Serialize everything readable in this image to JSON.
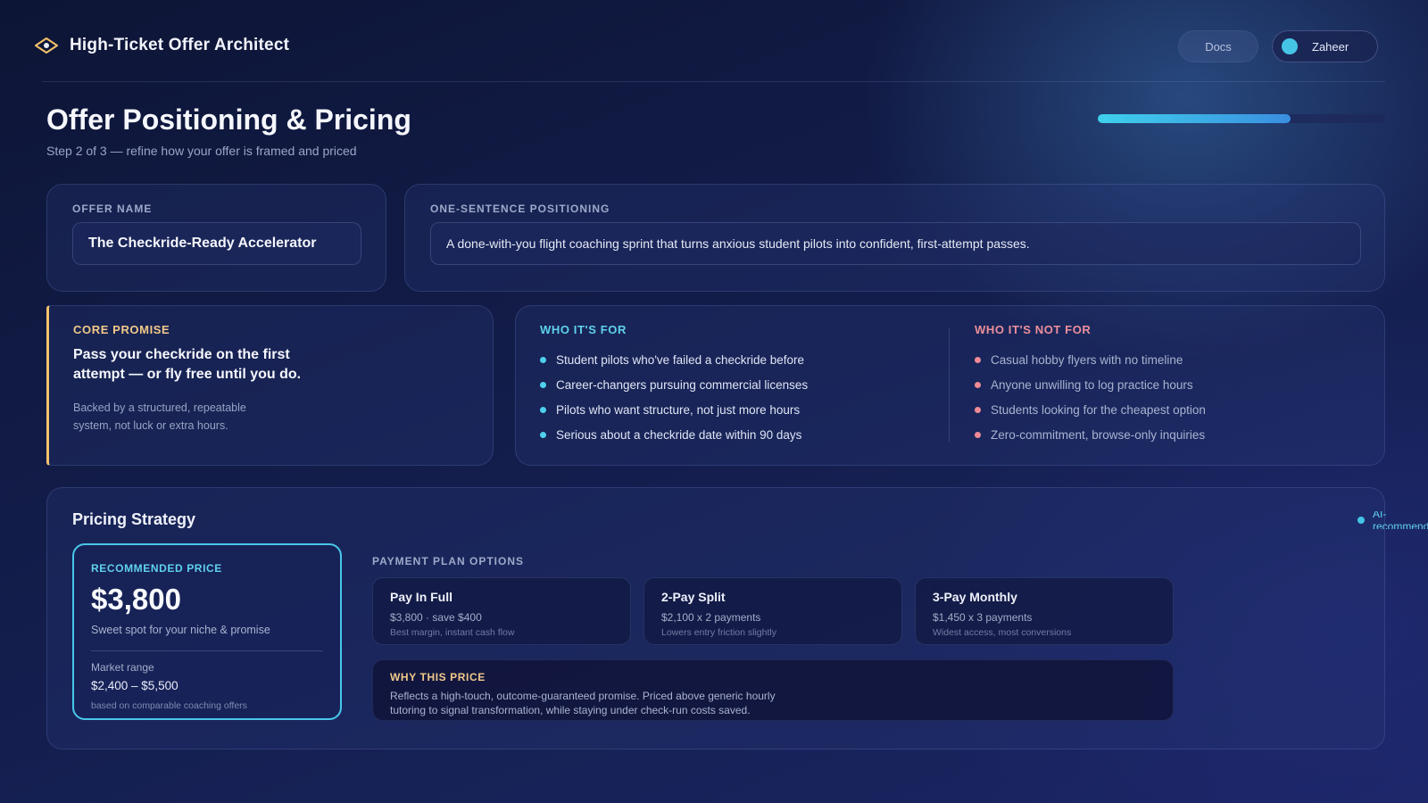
{
  "header": {
    "app_title": "High-Ticket Offer Architect",
    "docs_label": "Docs",
    "user_name": "Zaheer"
  },
  "page": {
    "title": "Offer Positioning & Pricing",
    "subtitle": "Step 2 of 3 — refine how your offer is framed and priced",
    "progress_fraction": 0.67
  },
  "offer_name": {
    "label": "OFFER NAME",
    "value": "The Checkride-Ready Accelerator"
  },
  "positioning": {
    "label": "ONE-SENTENCE POSITIONING",
    "value": "A done-with-you flight coaching sprint that turns anxious student pilots into confident, first-attempt passes."
  },
  "core_promise": {
    "label": "CORE PROMISE",
    "headline": "Pass your checkride on the first attempt — or fly free until you do.",
    "body": "Backed by a structured, repeatable system, not luck or extra hours."
  },
  "who_for": {
    "label": "WHO IT'S FOR",
    "items": [
      "Student pilots who've failed a checkride before",
      "Career-changers pursuing commercial licenses",
      "Pilots who want structure, not just more hours",
      "Serious about a checkride date within 90 days"
    ]
  },
  "who_not_for": {
    "label": "WHO IT'S NOT FOR",
    "items": [
      "Casual hobby flyers with no timeline",
      "Anyone unwilling to log practice hours",
      "Students looking for the cheapest option",
      "Zero-commitment, browse-only inquiries"
    ]
  },
  "pricing": {
    "title": "Pricing Strategy",
    "ai_badge": "AI-recommended",
    "recommended": {
      "label": "RECOMMENDED PRICE",
      "price": "$3,800",
      "description": "Sweet spot for your niche & promise",
      "range_label": "Market range",
      "range": "$2,400 – $5,500",
      "range_note": "based on comparable coaching offers"
    },
    "plans_label": "PAYMENT PLAN OPTIONS",
    "plans": [
      {
        "name": "Pay In Full",
        "detail": "$3,800 · save $400",
        "note": "Best margin, instant cash flow"
      },
      {
        "name": "2-Pay Split",
        "detail": "$2,100 x 2 payments",
        "note": "Lowers entry friction slightly"
      },
      {
        "name": "3-Pay Monthly",
        "detail": "$1,450 x 3 payments",
        "note": "Widest access, most conversions"
      }
    ],
    "why": {
      "label": "WHY THIS PRICE",
      "text": "Reflects a high-touch, outcome-guaranteed promise. Priced above generic hourly tutoring to signal transformation, while staying under check-run costs saved."
    }
  },
  "colors": {
    "accent_cyan": "#49c7ea",
    "accent_gold": "#f2c26b",
    "accent_rose": "#ee8b97"
  }
}
